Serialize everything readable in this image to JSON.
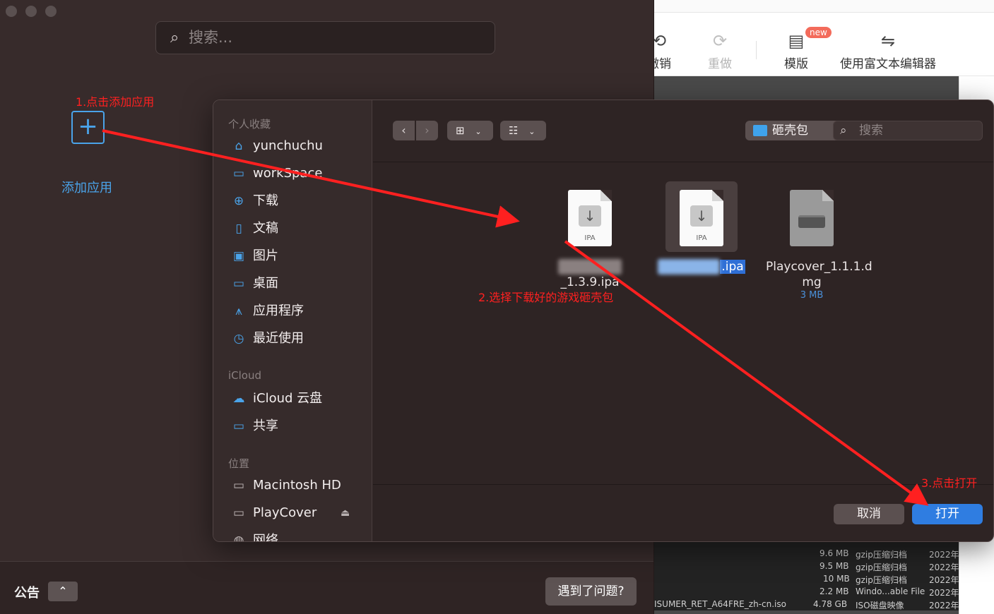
{
  "editor": {
    "toolbar": [
      {
        "label": "撤销",
        "icon": "undo-icon",
        "glyph": "⟲"
      },
      {
        "label": "重做",
        "icon": "redo-icon",
        "glyph": "⟳"
      },
      {
        "label": "模版",
        "icon": "template-icon",
        "glyph": "▤",
        "badge": "new"
      },
      {
        "label": "使用富文本编辑器",
        "icon": "switch-icon",
        "glyph": "⇋"
      }
    ],
    "files": [
      {
        "size": "9.6 MB",
        "kind": "gzip压缩归档",
        "date": "2022年"
      },
      {
        "size": "9.5 MB",
        "kind": "gzip压缩归档",
        "date": "2022年"
      },
      {
        "size": "10 MB",
        "kind": "gzip压缩归档",
        "date": "2022年"
      },
      {
        "size": "2.2 MB",
        "kind": "Windo...able File",
        "date": "2022年"
      },
      {
        "name": "ISUMER_RET_A64FRE_zh-cn.iso",
        "size": "4.78 GB",
        "kind": "ISO磁盘映像",
        "date": "2022年"
      }
    ]
  },
  "app": {
    "search_placeholder": "搜索...",
    "add_app_label": "添加应用",
    "notice_label": "公告",
    "problem_button": "遇到了问题?"
  },
  "dialog": {
    "sidebar": {
      "favorites_title": "个人收藏",
      "favorites": [
        {
          "label": "yunchuchu",
          "icon": "home-icon",
          "glyph": "⌂"
        },
        {
          "label": "workSpace",
          "icon": "folder-icon",
          "glyph": "▭"
        },
        {
          "label": "下载",
          "icon": "download-icon",
          "glyph": "⊕"
        },
        {
          "label": "文稿",
          "icon": "document-icon",
          "glyph": "▯"
        },
        {
          "label": "图片",
          "icon": "pictures-icon",
          "glyph": "▣"
        },
        {
          "label": "桌面",
          "icon": "desktop-icon",
          "glyph": "▭"
        },
        {
          "label": "应用程序",
          "icon": "applications-icon",
          "glyph": "⩚"
        },
        {
          "label": "最近使用",
          "icon": "recents-icon",
          "glyph": "◷"
        }
      ],
      "icloud_title": "iCloud",
      "icloud": [
        {
          "label": "iCloud 云盘",
          "icon": "cloud-icon",
          "glyph": "☁"
        },
        {
          "label": "共享",
          "icon": "shared-folder-icon",
          "glyph": "▭"
        }
      ],
      "locations_title": "位置",
      "locations": [
        {
          "label": "Macintosh HD",
          "icon": "disk-icon",
          "glyph": "▭"
        },
        {
          "label": "PlayCover",
          "icon": "disk-icon",
          "glyph": "▭"
        },
        {
          "label": "网络",
          "icon": "network-icon",
          "glyph": "◍"
        }
      ]
    },
    "path": "砸壳包",
    "search_placeholder": "搜索",
    "files": [
      {
        "name_suffix": "_1.3.9.ipa",
        "badge": "IPA"
      },
      {
        "name_suffix": ".ipa",
        "badge": "IPA"
      },
      {
        "name": "Playcover_1.1.1.dmg",
        "name_line1": "Playcover_1.1.1.d",
        "name_line2": "mg",
        "size": "3 MB"
      }
    ],
    "cancel_label": "取消",
    "open_label": "打开"
  },
  "annotations": {
    "step1": "1.点击添加应用",
    "step2": "2.选择下载好的游戏砸壳包",
    "step3": "3.点击打开"
  },
  "colors": {
    "accent": "#2f7de1",
    "annotation": "#ff2020",
    "app_bg": "#372b2b"
  }
}
